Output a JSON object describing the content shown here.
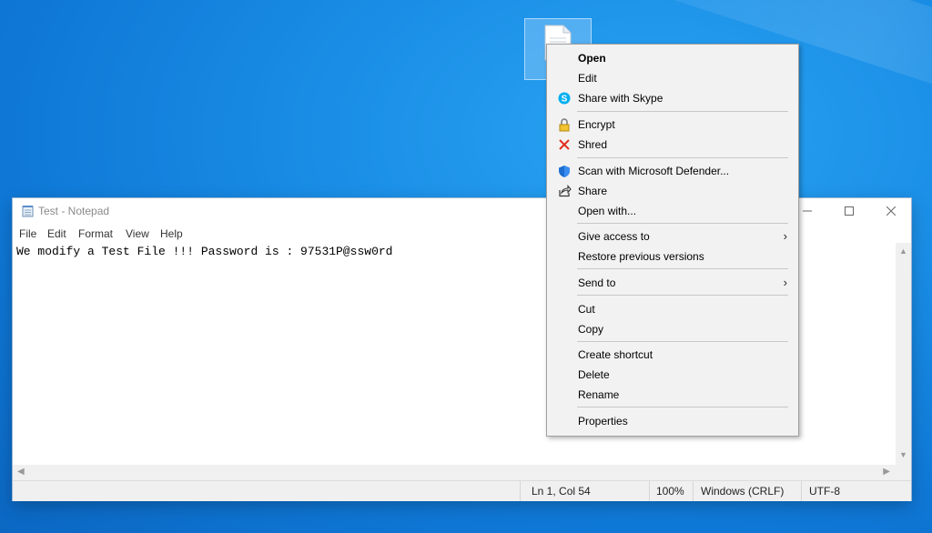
{
  "notepad": {
    "title": "Test - Notepad",
    "menu": [
      "File",
      "Edit",
      "Format",
      "View",
      "Help"
    ],
    "content": "We modify a Test File !!! Password is : 97531P@ssw0rd",
    "status": {
      "position": "Ln 1, Col 54",
      "zoom": "100%",
      "line_endings": "Windows (CRLF)",
      "encoding": "UTF-8"
    }
  },
  "context_menu": {
    "open": "Open",
    "edit": "Edit",
    "share_skype": "Share with Skype",
    "encrypt": "Encrypt",
    "shred": "Shred",
    "scan_defender": "Scan with Microsoft Defender...",
    "share": "Share",
    "open_with": "Open with...",
    "give_access": "Give access to",
    "restore_versions": "Restore previous versions",
    "send_to": "Send to",
    "cut": "Cut",
    "copy": "Copy",
    "create_shortcut": "Create shortcut",
    "delete": "Delete",
    "rename": "Rename",
    "properties": "Properties"
  },
  "icons": {
    "skype": "skype-icon",
    "encrypt": "lock-icon",
    "shred": "shred-icon",
    "defender": "shield-icon",
    "share": "share-icon"
  },
  "colors": {
    "desktop": "#1a8ee6",
    "skype": "#00aff0",
    "shred": "#e0301e",
    "defender": "#1e6fd0"
  }
}
